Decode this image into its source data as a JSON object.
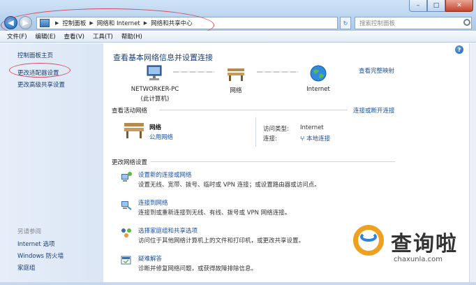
{
  "window": {
    "controls": [
      "–",
      "□",
      "✕"
    ]
  },
  "address_bar": {
    "breadcrumbs": [
      "控制面板",
      "网络和 Internet",
      "网络和共享中心"
    ]
  },
  "search": {
    "placeholder": "搜索控制面板"
  },
  "menu": [
    "文件(F)",
    "编辑(E)",
    "查看(V)",
    "工具(T)",
    "帮助(H)"
  ],
  "sidebar": {
    "links": [
      "控制面板主页",
      "更改适配器设置",
      "更改高级共享设置"
    ],
    "see_also_heading": "另请参阅",
    "see_also": [
      "Internet 选项",
      "Windows 防火墙",
      "家庭组"
    ]
  },
  "main": {
    "title": "查看基本网络信息并设置连接",
    "full_map_link": "查看完整映射",
    "map": {
      "computer_name": "NETWORKER-PC",
      "computer_sub": "(此计算机)",
      "network": "网络",
      "internet": "Internet"
    },
    "active_heading": "查看活动网络",
    "connect_link": "连接或断开连接",
    "active_network": {
      "name": "网络",
      "type": "公用网络",
      "access_label": "访问类型:",
      "access_value": "Internet",
      "conn_label": "连接:",
      "conn_value": "本地连接"
    },
    "change_heading": "更改网络设置",
    "tasks": [
      {
        "title": "设置新的连接或网络",
        "desc": "设置无线、宽带、拨号、临时或 VPN 连接；或设置路由器或访问点。"
      },
      {
        "title": "连接到网络",
        "desc": "连接到或重新连接到无线、有线、拨号或 VPN 网络连接。"
      },
      {
        "title": "选择家庭组和共享选项",
        "desc": "访问位于其他网络计算机上的文件和打印机，或更改共享设置。"
      },
      {
        "title": "疑难解答",
        "desc": "诊断并修复网络问题，或获得故障排除信息。"
      }
    ]
  },
  "watermark": {
    "brand_cn": "查询啦",
    "brand_en": "chaxunla.com"
  },
  "colors": {
    "accent_link": "#1c4f9c",
    "annotation": "#d64a5c"
  }
}
